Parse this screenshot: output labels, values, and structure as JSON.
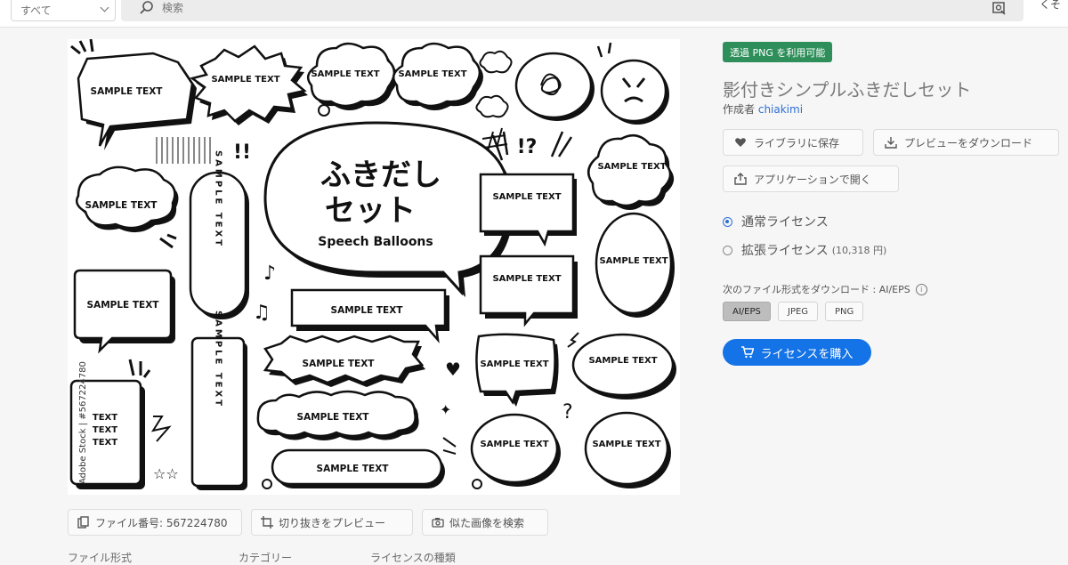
{
  "search": {
    "scope_label": "すべて",
    "placeholder": "検索",
    "right_label": "くそ"
  },
  "preview": {
    "heading_jp_line1": "ふきだし",
    "heading_jp_line2": "セット",
    "heading_en": "Speech Balloons",
    "balloon_text": "SAMPLE TEXT",
    "balloon_text_stacked": "SAMPLE TEXT",
    "vertical_text": "SAMPLE TEXT",
    "multi_text": [
      "TEXT",
      "TEXT",
      "TEXT"
    ],
    "watermark": "Adobe Stock | #567224780",
    "marks": [
      "!!",
      "!?",
      "?"
    ]
  },
  "actions": {
    "file_number": "ファイル番号: 567224780",
    "crop_preview": "切り抜きをプレビュー",
    "find_similar": "似た画像を検索"
  },
  "meta_headings": [
    "ファイル形式",
    "カテゴリー",
    "ライセンスの種類"
  ],
  "details": {
    "badge": "透過 PNG を利用可能",
    "title": "影付きシンプルふきだしセット",
    "author_prefix": "作成者",
    "author_name": "chiakimi",
    "save_library": "ライブラリに保存",
    "download_preview": "プレビューをダウンロード",
    "open_in_app": "アプリケーションで開く",
    "license_standard": "通常ライセンス",
    "license_extended": "拡張ライセンス",
    "license_extended_price": "(10,318 円)",
    "format_prompt": "次のファイル形式をダウンロード : AI/EPS",
    "formats": [
      "AI/EPS",
      "JPEG",
      "PNG"
    ],
    "selected_format": "AI/EPS",
    "buy_button": "ライセンスを購入"
  },
  "colors": {
    "badge": "#2f8f5b",
    "accent": "#1473e6",
    "link": "#2d6fd6"
  }
}
